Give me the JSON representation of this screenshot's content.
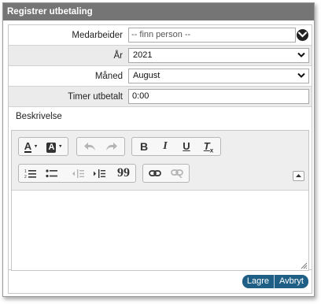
{
  "dialog": {
    "title": "Registrer utbetaling"
  },
  "form": {
    "employee": {
      "label": "Medarbeider",
      "placeholder": "-- finn person --"
    },
    "year": {
      "label": "År",
      "value": "2021"
    },
    "month": {
      "label": "Måned",
      "value": "August"
    },
    "hours": {
      "label": "Timer utbetalt",
      "value": "0:00"
    },
    "description": {
      "label": "Beskrivelse"
    }
  },
  "editor": {
    "icons": {
      "font_color": "font-color-icon",
      "bg_color": "background-color-icon",
      "undo": "undo-icon",
      "redo": "redo-icon",
      "bold": "bold-icon",
      "italic": "italic-icon",
      "underline": "underline-icon",
      "remove_format": "remove-format-icon",
      "numbered_list": "numbered-list-icon",
      "bulleted_list": "bulleted-list-icon",
      "outdent": "outdent-icon",
      "indent": "indent-icon",
      "blockquote": "blockquote-icon",
      "link": "link-icon",
      "unlink": "unlink-icon",
      "collapse": "collapse-toolbar-icon"
    },
    "glyphs": {
      "font_color": "A",
      "bg_color": "A",
      "bold": "B",
      "italic": "I",
      "underline": "U",
      "remove_format": "T",
      "remove_format_sub": "x",
      "blockquote": "99"
    }
  },
  "footer": {
    "save_label": "Lagre",
    "cancel_label": "Avbryt"
  },
  "colors": {
    "titlebar": "#757575",
    "button": "#1f5f86",
    "alt_row": "#ebebeb"
  }
}
